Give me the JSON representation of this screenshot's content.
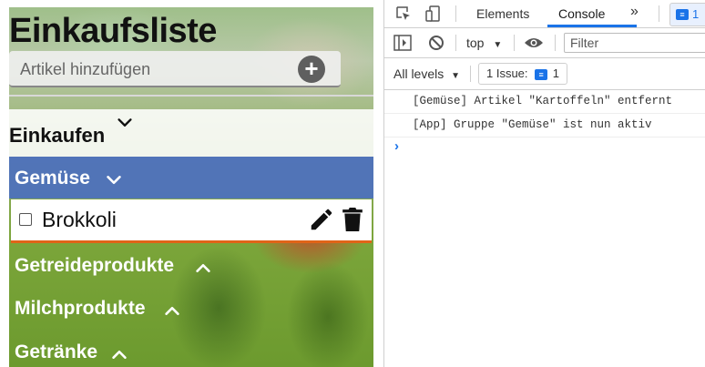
{
  "app": {
    "title": "Einkaufsliste",
    "add_placeholder": "Artikel hinzufügen",
    "add_icon": "plus-icon",
    "section_title": "Einkaufen",
    "groups": [
      {
        "label": "Gemüse",
        "expanded": true
      },
      {
        "label": "Getreideprodukte",
        "expanded": false
      },
      {
        "label": "Milchprodukte",
        "expanded": false
      },
      {
        "label": "Getränke",
        "expanded": false
      }
    ],
    "items": [
      {
        "label": "Brokkoli",
        "checked": false
      }
    ],
    "colors": {
      "active_group": "#4c70be",
      "item_border": "#e06418"
    }
  },
  "devtools": {
    "tabs": [
      "Elements",
      "Console"
    ],
    "active_tab": "Console",
    "more_tabs": "»",
    "issues_count": "1",
    "context": "top",
    "filter_placeholder": "Filter",
    "levels": "All levels",
    "issue_chip_label": "1 Issue:",
    "issue_chip_count": "1",
    "logs": [
      "[Gemüse] Artikel \"Kartoffeln\" entfernt",
      "[App] Gruppe \"Gemüse\" ist nun aktiv"
    ],
    "prompt": "›",
    "colors": {
      "accent": "#1a73e8"
    }
  }
}
